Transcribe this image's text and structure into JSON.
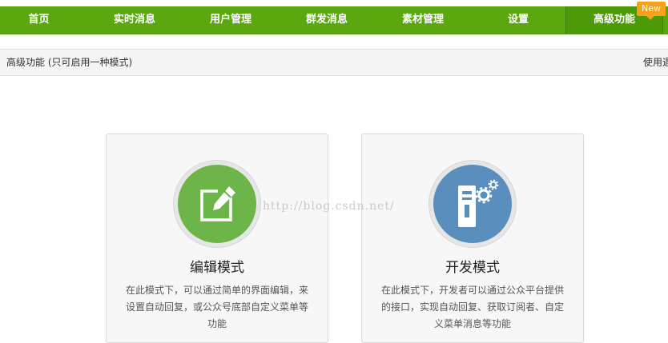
{
  "nav": {
    "items": [
      {
        "label": "首页"
      },
      {
        "label": "实时消息"
      },
      {
        "label": "用户管理"
      },
      {
        "label": "群发消息"
      },
      {
        "label": "素材管理"
      },
      {
        "label": "设置"
      },
      {
        "label": "高级功能"
      }
    ],
    "active_index": 6,
    "badge": "New"
  },
  "subbar": {
    "title": "高级功能 (只可启用一种模式)",
    "right_text": "使用遇"
  },
  "cards": [
    {
      "title": "编辑模式",
      "description": "在此模式下，可以通过简单的界面编辑，来设置自动回复，或公众号底部自定义菜单等功能",
      "icon": "edit-icon",
      "color": "#6db548"
    },
    {
      "title": "开发模式",
      "description": "在此模式下，开发者可以通过公众平台提供的接口，实现自动回复、获取订阅者、自定义菜单消息等功能",
      "icon": "server-gear-icon",
      "color": "#5a8fbd"
    }
  ],
  "watermark": "http://blog.csdn.net/",
  "colors": {
    "nav_bg": "#5aa70f",
    "badge_bg": "#f5a21a"
  }
}
